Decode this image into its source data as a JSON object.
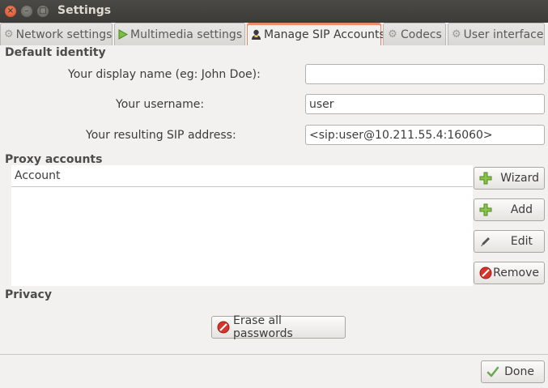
{
  "window": {
    "title": "Settings"
  },
  "tabs": [
    {
      "label": "Network settings",
      "icon": "gear-icon"
    },
    {
      "label": "Multimedia settings",
      "icon": "play-icon"
    },
    {
      "label": "Manage SIP Accounts",
      "icon": "user-icon",
      "active": true
    },
    {
      "label": "Codecs",
      "icon": "gear-icon"
    },
    {
      "label": "User interface",
      "icon": "gear-icon"
    }
  ],
  "default_identity": {
    "title": "Default identity",
    "display_name_label": "Your display name (eg: John Doe):",
    "display_name_value": "",
    "username_label": "Your username:",
    "username_value": "user",
    "sip_address_label": "Your resulting SIP address:",
    "sip_address_value": "<sip:user@10.211.55.4:16060>"
  },
  "proxy_accounts": {
    "title": "Proxy accounts",
    "column_header": "Account",
    "rows": [],
    "buttons": {
      "wizard": "Wizard",
      "add": "Add",
      "edit": "Edit",
      "remove": "Remove"
    }
  },
  "privacy": {
    "title": "Privacy",
    "erase_button": "Erase all passwords"
  },
  "footer": {
    "done_button": "Done"
  },
  "colors": {
    "accent": "#f28c63",
    "titlebar": "#3c3b37",
    "close": "#e0582f"
  }
}
